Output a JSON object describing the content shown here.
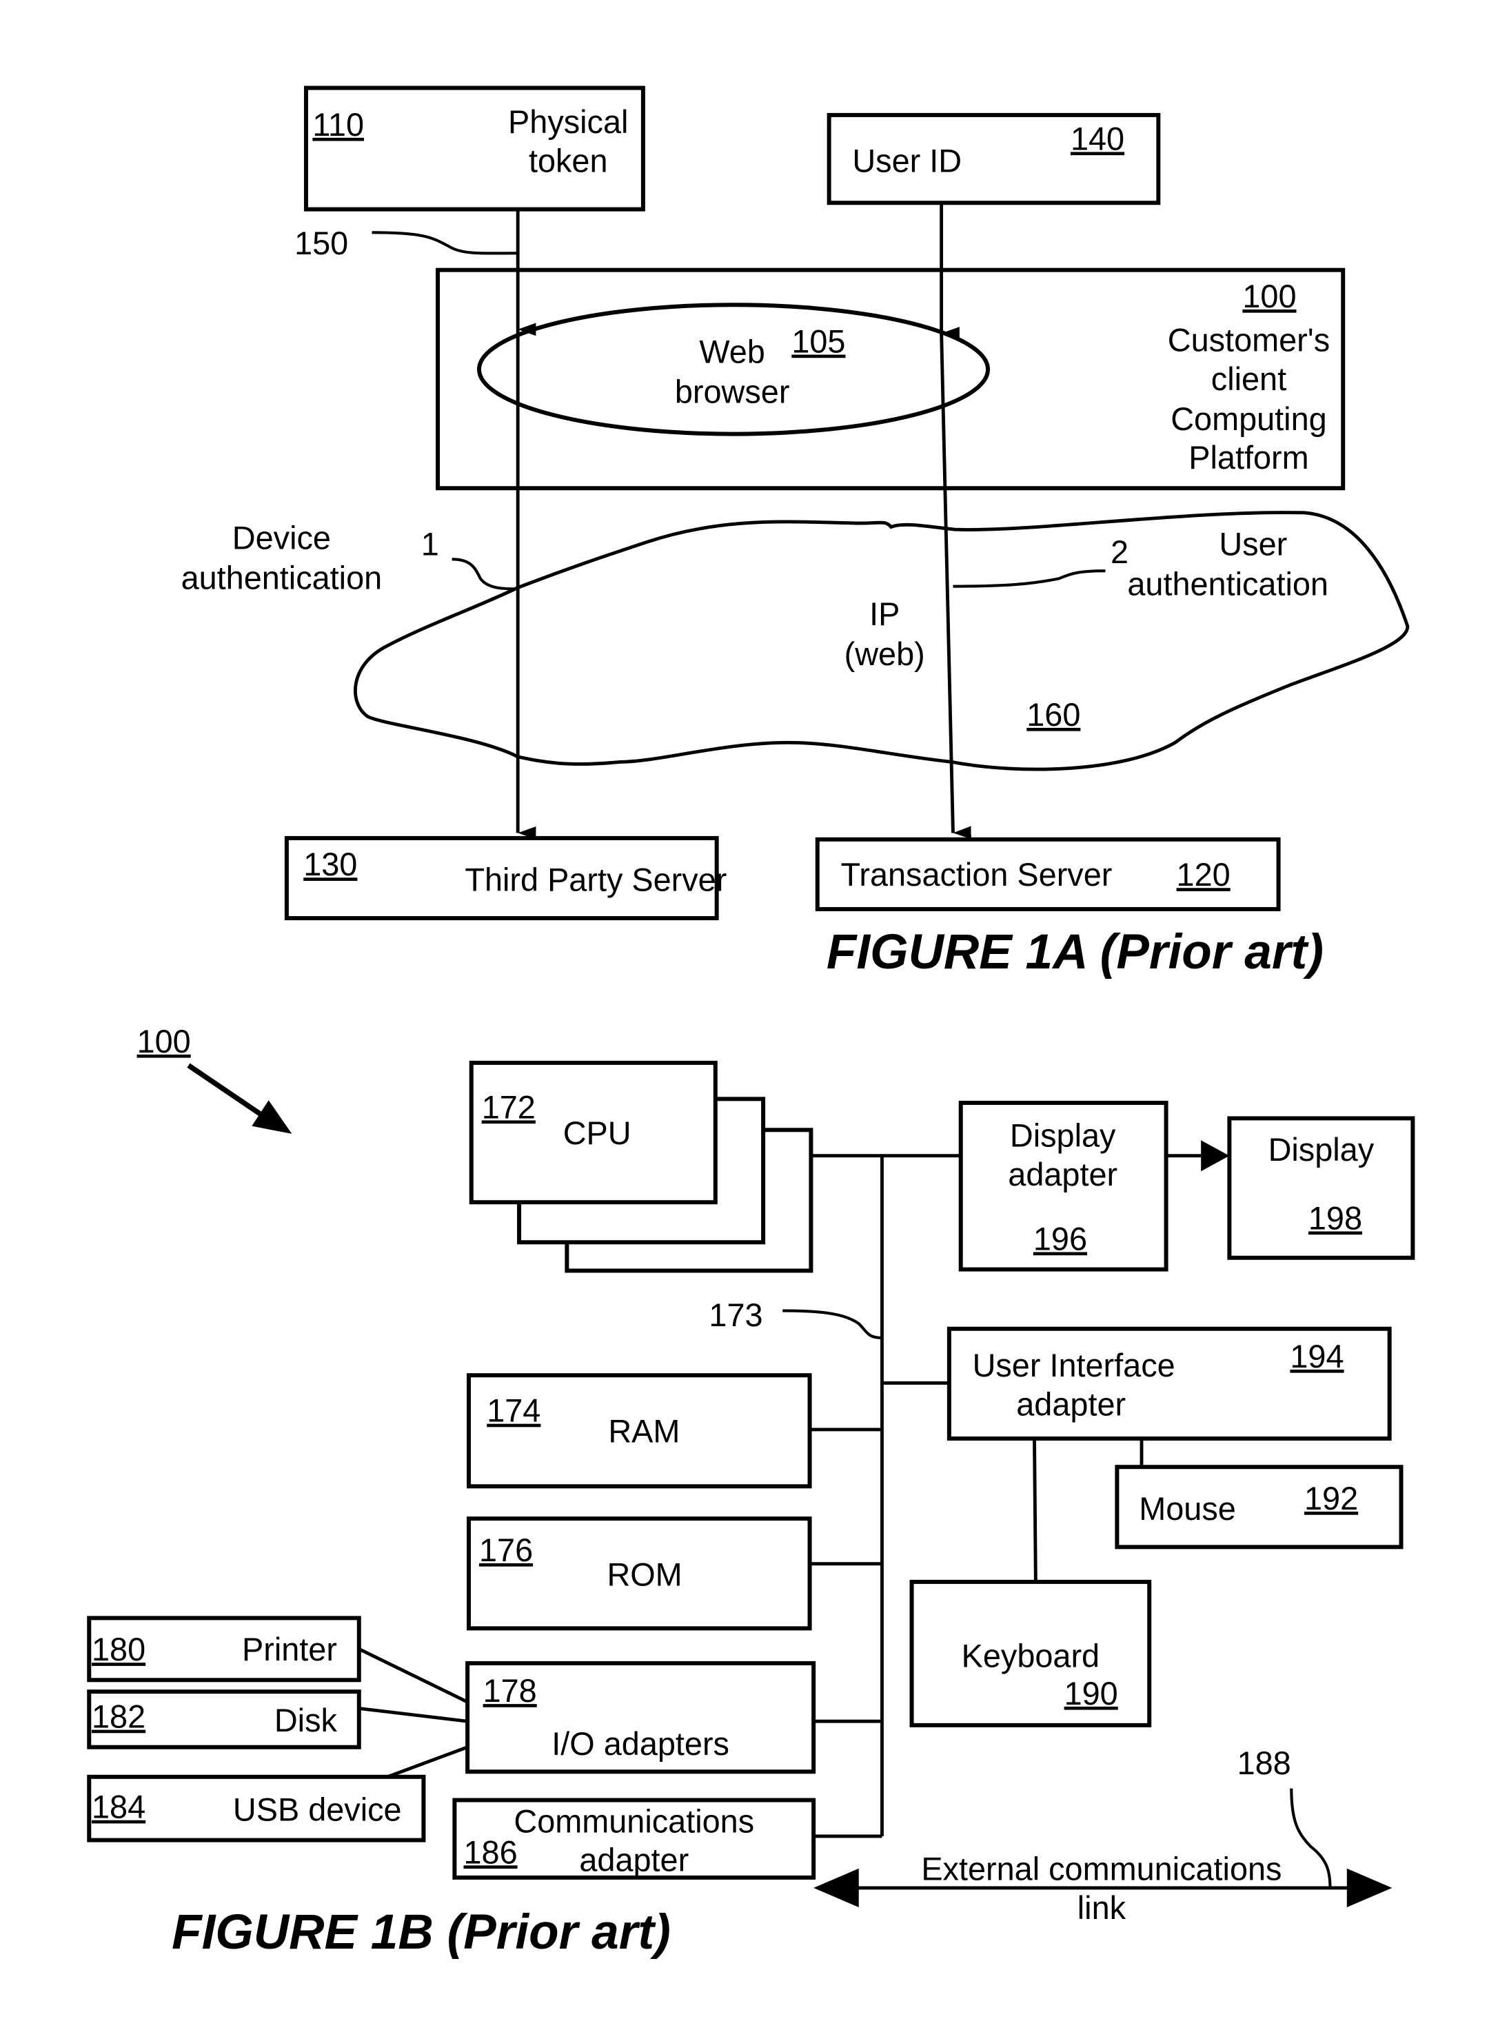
{
  "figure_1a": {
    "caption": "FIGURE 1A (Prior art)",
    "physical_token": {
      "ref": "110",
      "label_line1": "Physical",
      "label_line2": "token"
    },
    "user_id": {
      "ref": "140",
      "label": "User ID"
    },
    "connector_150": "150",
    "client_platform": {
      "ref": "100",
      "label_lines": [
        "Customer's",
        "client",
        "Computing",
        "Platform"
      ]
    },
    "web_browser": {
      "ref": "105",
      "label_line1": "Web",
      "label_line2": "browser"
    },
    "device_auth": {
      "label_line1": "Device",
      "label_line2": "authentication",
      "step": "1"
    },
    "user_auth": {
      "label_line1": "User",
      "label_line2": "authentication",
      "step": "2"
    },
    "network": {
      "ref": "160",
      "label_line1": "IP",
      "label_line2": "(web)"
    },
    "third_party_server": {
      "ref": "130",
      "label": "Third Party Server"
    },
    "transaction_server": {
      "ref": "120",
      "label": "Transaction Server"
    }
  },
  "figure_1b": {
    "caption": "FIGURE 1B (Prior art)",
    "system_ref": "100",
    "cpu": {
      "ref": "172",
      "label": "CPU"
    },
    "bus_ref": "173",
    "display_adapter": {
      "ref": "196",
      "label_line1": "Display",
      "label_line2": "adapter"
    },
    "display": {
      "ref": "198",
      "label": "Display"
    },
    "ui_adapter": {
      "ref": "194",
      "label_line1": "User  Interface",
      "label_line2": "adapter"
    },
    "mouse": {
      "ref": "192",
      "label": "Mouse"
    },
    "ram": {
      "ref": "174",
      "label": "RAM"
    },
    "rom": {
      "ref": "176",
      "label": "ROM"
    },
    "keyboard": {
      "ref": "190",
      "label": "Keyboard"
    },
    "printer": {
      "ref": "180",
      "label": "Printer"
    },
    "disk": {
      "ref": "182",
      "label": "Disk"
    },
    "usb": {
      "ref": "184",
      "label": "USB device"
    },
    "io_adapters": {
      "ref": "178",
      "label": "I/O adapters"
    },
    "comm_adapter": {
      "ref": "186",
      "label_line1": "Communications",
      "label_line2": "adapter"
    },
    "ext_link": {
      "ref": "188",
      "label_line1": "External communications",
      "label_line2": "link"
    }
  }
}
